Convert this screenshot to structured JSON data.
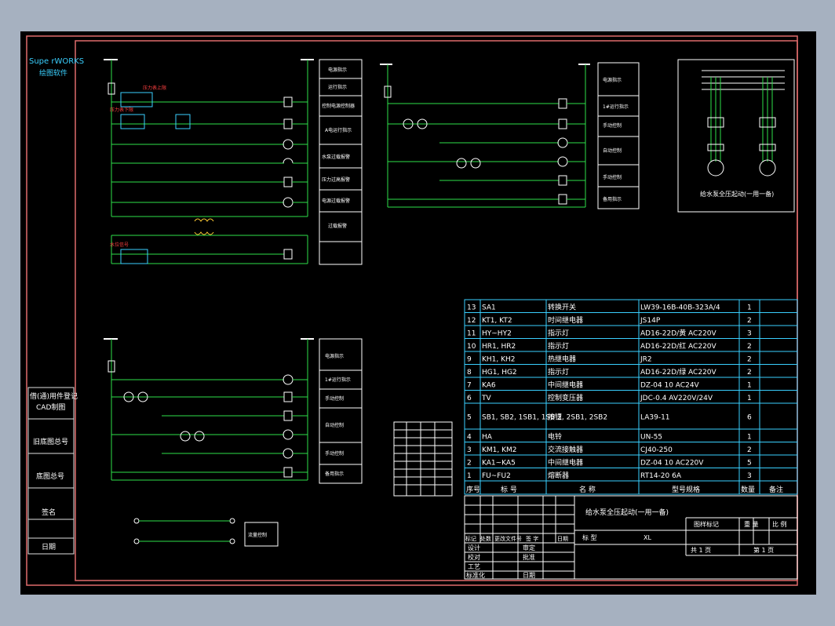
{
  "brand": {
    "name": "Supe rWORKS",
    "sub": "绘图软件"
  },
  "left_strip": [
    {
      "label": "借(通)用件登记"
    },
    {
      "label": "CAD制图"
    },
    {
      "label": "旧底图总号"
    },
    {
      "label": "底图总号"
    },
    {
      "label": "签名"
    },
    {
      "label": "日期"
    }
  ],
  "circuit_a_labels": [
    "电源指示",
    "运行指示",
    "控制电源控制器",
    "A电运行指示",
    "水泵过载报警",
    "压力过高报警",
    "电源过载报警",
    "过载报警"
  ],
  "circuit_b_labels": [
    "电源指示",
    "1#运行指示",
    "手动控制",
    "自动控制",
    "手动控制",
    "备用指示"
  ],
  "circuit_c_labels": [
    "电源指示",
    "1#运行指示",
    "手动控制",
    "自动控制",
    "手动控制",
    "备用指示"
  ],
  "pump_panel": {
    "caption": "给水泵全压起动(一用一备)"
  },
  "small_box": {
    "label": "流量控制"
  },
  "bom_rows": [
    {
      "no": "13",
      "sym": "SA1",
      "name": "转换开关",
      "model": "LW39-16B-40B-323A/4",
      "qty": "1"
    },
    {
      "no": "12",
      "sym": "KT1, KT2",
      "name": "时间继电器",
      "model": "JS14P",
      "qty": "2"
    },
    {
      "no": "11",
      "sym": "HY~HY2",
      "name": "指示灯",
      "model": "AD16-22D/黄 AC220V",
      "qty": "3"
    },
    {
      "no": "10",
      "sym": "HR1, HR2",
      "name": "指示灯",
      "model": "AD16-22D/红 AC220V",
      "qty": "2"
    },
    {
      "no": "9",
      "sym": "KH1, KH2",
      "name": "热继电器",
      "model": "JR2",
      "qty": "2"
    },
    {
      "no": "8",
      "sym": "HG1, HG2",
      "name": "指示灯",
      "model": "AD16-22D/绿 AC220V",
      "qty": "2"
    },
    {
      "no": "7",
      "sym": "KA6",
      "name": "中间继电器",
      "model": "DZ-04 10 AC24V",
      "qty": "1"
    },
    {
      "no": "6",
      "sym": "TV",
      "name": "控制变压器",
      "model": "JDC-0.4 AV220V/24V",
      "qty": "1"
    },
    {
      "no": "5",
      "sym": "SB1, SB2, 1SB1, 1SB 2, 2SB1, 2SB2",
      "name": "按钮",
      "model": "LA39-11",
      "qty": "6"
    },
    {
      "no": "4",
      "sym": "HA",
      "name": "电铃",
      "model": "UN-55",
      "qty": "1"
    },
    {
      "no": "3",
      "sym": "KM1, KM2",
      "name": "交流接触器",
      "model": "CJ40-250",
      "qty": "2"
    },
    {
      "no": "2",
      "sym": "KA1~KA5",
      "name": "中间继电器",
      "model": "DZ-04 10 AC220V",
      "qty": "5"
    },
    {
      "no": "1",
      "sym": "FU~FU2",
      "name": "熔断器",
      "model": "RT14-20 6A",
      "qty": "3"
    }
  ],
  "bom_header": {
    "no": "序号",
    "sym": "标 号",
    "name": "名 称",
    "model": "型号规格",
    "qty": "数量",
    "note": "备注"
  },
  "title_block": {
    "title": "给水泵全压起动(一用一备)",
    "type_label": "标 型",
    "type_value": "XL",
    "mark_label": "图样标记",
    "weight_label": "重 量",
    "scale_label": "比 例",
    "sheets_total": "共 1 页",
    "sheet_no": "第 1 页",
    "rev_headers": [
      "标记",
      "处数",
      "更改文件号",
      "签 字",
      "日期"
    ],
    "roles": [
      "设计",
      "校对",
      "工艺",
      "标准化"
    ],
    "roles2": [
      "审定",
      "批准",
      "",
      "日期"
    ]
  }
}
